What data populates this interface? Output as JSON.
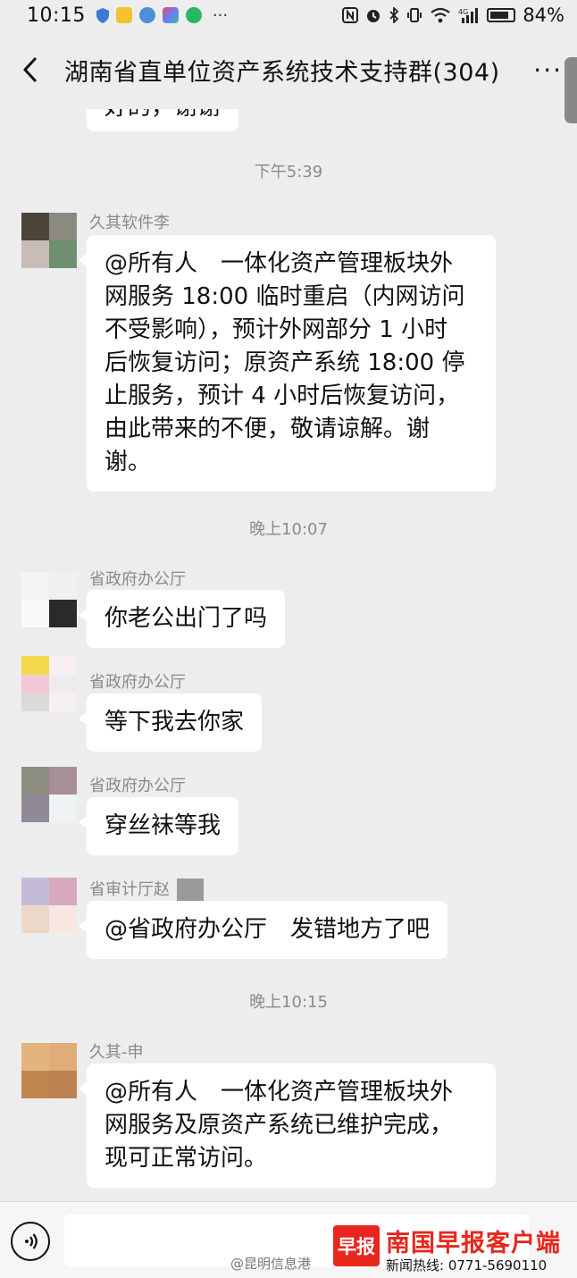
{
  "status_bar": {
    "time": "10:15",
    "more": "···",
    "battery": "84%",
    "battery_level": 0.84,
    "left_icons": [
      "shield-icon",
      "app-icon-yellow",
      "app-icon-blue",
      "app-icon-square",
      "app-icon-green"
    ],
    "right_icons": [
      "nfc-icon",
      "alarm-icon",
      "bluetooth-icon",
      "vibrate-icon",
      "wifi-icon",
      "4g-signal-icon",
      "battery-icon"
    ],
    "network_label": "4G"
  },
  "header": {
    "back_icon": "back-arrow-icon",
    "title": "湖南省直单位资产系统技术支持群(304)",
    "more_label": "···"
  },
  "chat": {
    "partial_message": "好的，谢谢",
    "messages": [
      {
        "timestamp": "下午5:39",
        "sender": "久其软件李",
        "text": "@所有人　一体化资产管理板块外网服务 18:00 临时重启（内网访问不受影响），预计外网部分 1 小时后恢复访问；原资产系统 18:00 停止服务，预计 4 小时后恢复访问，由此带来的不便，敬请谅解。谢谢。",
        "lines": [
          "@所有人　一体化资产管理板块外",
          "网服务 18:00 临时重启（内网访问",
          "不受影响），预计外网部分 1 小时",
          "后恢复访问；原资产系统 18:00 停",
          "止服务，预计 4 小时后恢复访问，",
          "由此带来的不便，敬请谅解。谢",
          "谢。"
        ],
        "avatar_colors": [
          "#4a4538",
          "#8a8a80",
          "#c8bcb6",
          "#6e8f70"
        ]
      },
      {
        "timestamp": "晚上10:07",
        "sender": "省政府办公厅",
        "text": "你老公出门了吗",
        "avatar_colors": [
          "#f4f4f4",
          "#f0f0f0",
          "#fafafa",
          "#2a2a2a"
        ]
      },
      {
        "sender": "省政府办公厅",
        "text": "等下我去你家",
        "avatar_colors": [
          "#f3d84a",
          "#f8eef2",
          "#f2c8d6",
          "#ececec",
          "#dcdad6",
          "#f6f0f0"
        ]
      },
      {
        "sender": "省政府办公厅",
        "text": "穿丝袜等我",
        "avatar_colors": [
          "#8c8c80",
          "#a88e98",
          "#908a96",
          "#eef2f2"
        ]
      },
      {
        "sender": "省审计厅赵",
        "text": "@省政府办公厅　发错地方了吧",
        "avatar_colors": [
          "#c4bcd6",
          "#d8a8bc",
          "#ecd8c8",
          "#f8e6e2"
        ]
      },
      {
        "timestamp": "晚上10:15",
        "sender": "久其-申",
        "text": "@所有人　一体化资产管理板块外网服务及原资产系统已维护完成，现可正常访问。",
        "lines": [
          "@所有人　一体化资产管理板块外",
          "网服务及原资产系统已维护完成，",
          "现可正常访问。"
        ],
        "avatar_colors": [
          "#e4b47e",
          "#e0ac78",
          "#c08650",
          "#bc8250"
        ]
      }
    ]
  },
  "bottom_bar": {
    "voice_icon": "voice-icon",
    "watermark_weibo": "@昆明信息港",
    "brand_logo": "早报",
    "brand_name": "南国早报客户端",
    "brand_hotline": "新闻热线: 0771-5690110"
  },
  "colors": {
    "background": "#ededed",
    "bubble": "#ffffff",
    "brand_red": "#e8261d",
    "meta_gray": "#8a8a8a"
  }
}
